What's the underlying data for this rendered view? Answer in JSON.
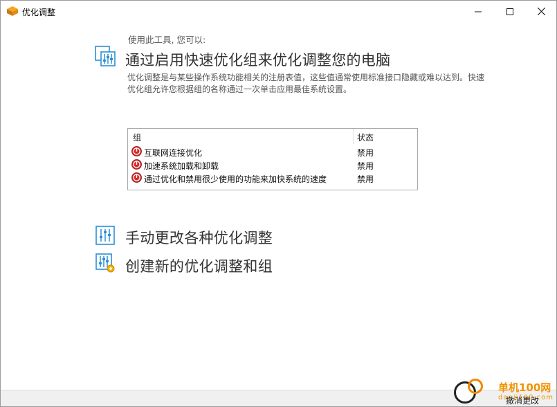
{
  "window": {
    "title": "优化调整",
    "controls": {
      "minimize": "—",
      "maximize": "☐",
      "close": "✕"
    }
  },
  "main": {
    "intro": "使用此工具, 您可以:",
    "options": [
      {
        "title": "通过启用快速优化组来优化调整您的电脑",
        "icon": "sliders-icon"
      },
      {
        "title": "手动更改各种优化调整",
        "icon": "sliders-icon"
      },
      {
        "title": "创建新的优化调整和组",
        "icon": "sliders-gear-icon"
      }
    ],
    "description": "优化调整是与某些操作系统功能相关的注册表值，这些值通常使用标准接口隐藏或难以达到。快速优化组允许您根据组的名称通过一次单击应用最佳系统设置。",
    "table": {
      "headers": {
        "group": "组",
        "status": "状态"
      },
      "rows": [
        {
          "name": "互联网连接优化",
          "status": "禁用"
        },
        {
          "name": "加速系统加载和卸载",
          "status": "禁用"
        },
        {
          "name": "通过优化和禁用很少使用的功能来加快系统的速度",
          "status": "禁用"
        }
      ]
    }
  },
  "watermark": {
    "brand": "单机100网",
    "domain": "danji100.com"
  },
  "statusbar": {
    "revert_label": "撤消更改"
  },
  "colors": {
    "accent_icon": "#2a8fd6",
    "disabled_icon": "#d42a2a",
    "watermark": "#f39200"
  }
}
